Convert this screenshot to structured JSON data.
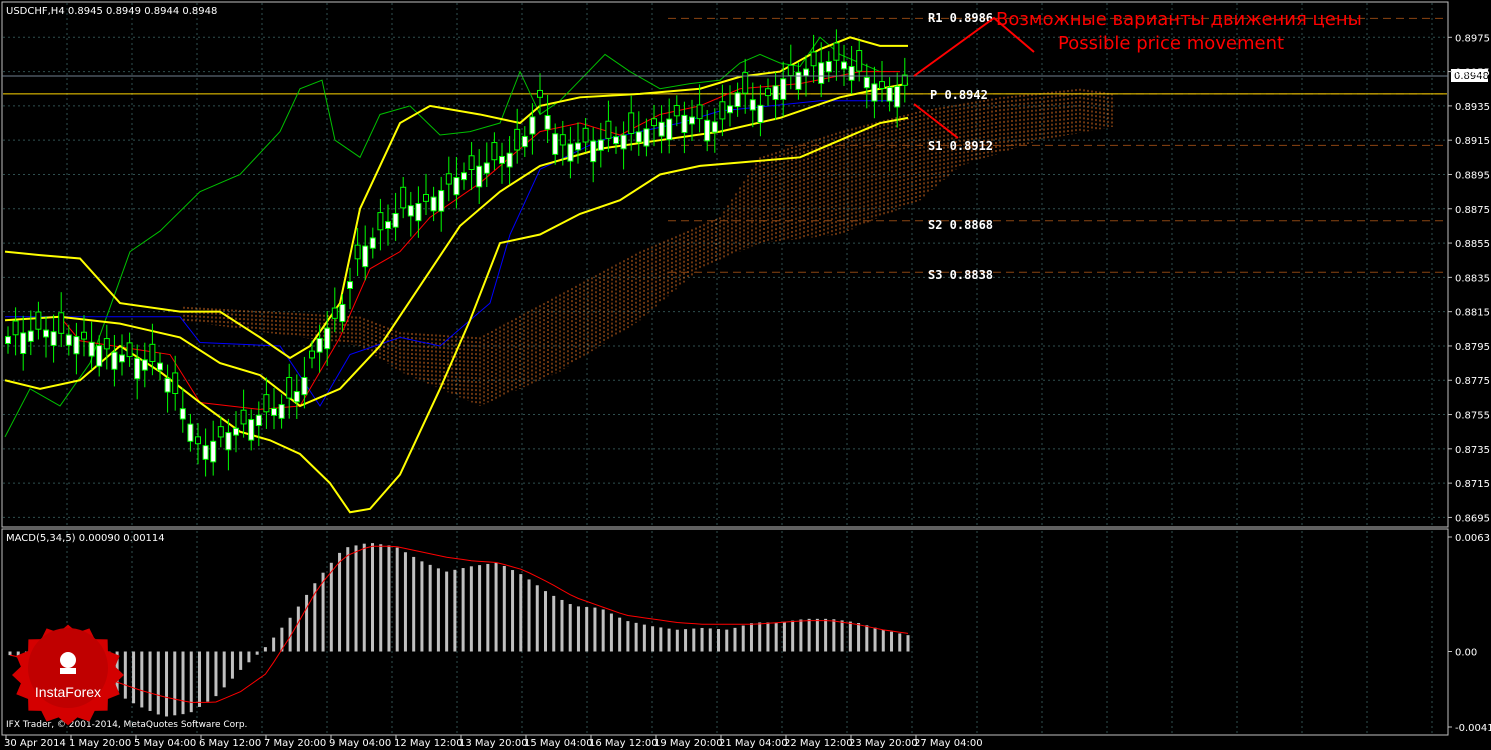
{
  "main_panel": {
    "title": "USDCHF,H4  0.8945 0.8949 0.8944 0.8948",
    "current_price_label": "0.8948",
    "price_ticks": [
      "0.8975",
      "0.8955",
      "0.8935",
      "0.8915",
      "0.8895",
      "0.8875",
      "0.8855",
      "0.8835",
      "0.8815",
      "0.8795",
      "0.8775",
      "0.8755",
      "0.8735",
      "0.8715",
      "0.8695"
    ]
  },
  "annotations": {
    "russian_text": "Возможные варианты движения цены",
    "english_text": "Possible price movement"
  },
  "pivot_levels": [
    {
      "name": "R1",
      "value": 0.8986,
      "label": "R1  0.8986"
    },
    {
      "name": "P",
      "value": 0.8942,
      "label": "P  0.8942"
    },
    {
      "name": "S1",
      "value": 0.8912,
      "label": "S1  0.8912"
    },
    {
      "name": "S2",
      "value": 0.8868,
      "label": "S2  0.8868"
    },
    {
      "name": "S3",
      "value": 0.8838,
      "label": "S3  0.8838"
    }
  ],
  "macd_panel": {
    "title": "MACD(5,34,5) 0.00090 0.00114",
    "ticks": [
      "0.00631",
      "0.00",
      "-0.00416"
    ]
  },
  "x_axis_labels": [
    "30 Apr 2014",
    "1 May 20:00",
    "5 May 04:00",
    "6 May 12:00",
    "7 May 20:00",
    "9 May 04:00",
    "12 May 12:00",
    "13 May 20:00",
    "15 May 04:00",
    "16 May 12:00",
    "19 May 20:00",
    "21 May 04:00",
    "22 May 12:00",
    "23 May 20:00",
    "27 May 04:00"
  ],
  "footer": {
    "copyright": "IFX Trader, © 2001-2014, MetaQuotes Software Corp.",
    "logo_text": "InstaForex"
  },
  "colors": {
    "background": "#000000",
    "grid": "#2f4f4f",
    "bollinger": "#ffff00",
    "tenkan": "#ff0000",
    "kijun": "#0000ff",
    "chikou": "#00c000",
    "kumo": "#d2691e",
    "pivot": "#8b4513",
    "macd_hist": "#c0c0c0",
    "macd_signal": "#ff0000",
    "annotation": "#ff0000",
    "bull_candle": "#ffffff",
    "bear_candle": "#000000"
  },
  "chart_data": {
    "type": "line",
    "symbol": "USDCHF",
    "timeframe": "H4",
    "x": [
      0,
      5,
      10,
      15,
      20,
      25,
      30,
      35,
      40,
      45,
      50,
      55,
      60,
      65,
      70,
      75,
      80,
      85,
      90,
      95,
      100,
      105,
      110,
      115,
      120,
      125,
      130,
      135,
      140
    ],
    "close": [
      0.8805,
      0.8795,
      0.8788,
      0.8801,
      0.8803,
      0.879,
      0.878,
      0.8779,
      0.8775,
      0.874,
      0.8742,
      0.8745,
      0.8755,
      0.876,
      0.8795,
      0.8835,
      0.887,
      0.888,
      0.8895,
      0.8905,
      0.89,
      0.8915,
      0.892,
      0.8925,
      0.8932,
      0.894,
      0.8955,
      0.8963,
      0.8948
    ],
    "bb_upper": [
      0.885,
      0.8845,
      0.882,
      0.8818,
      0.8805,
      0.88,
      0.879,
      0.878,
      0.877,
      0.879,
      0.8885,
      0.8925,
      0.8935,
      0.893,
      0.8935,
      0.8945,
      0.8945,
      0.8948,
      0.895,
      0.895,
      0.895,
      0.8955,
      0.896,
      0.8975,
      0.8978,
      0.8972
    ],
    "bb_lower": [
      0.8775,
      0.877,
      0.8772,
      0.8775,
      0.875,
      0.874,
      0.8735,
      0.872,
      0.87,
      0.87,
      0.874,
      0.88,
      0.884,
      0.886,
      0.887,
      0.8875,
      0.8885,
      0.8895,
      0.89,
      0.8902,
      0.8905,
      0.891,
      0.892,
      0.8925
    ],
    "ylim": [
      0.869,
      0.8995
    ],
    "grid": true,
    "macd": {
      "histogram": [
        -0.0002,
        -0.0006,
        -0.001,
        -0.0015,
        -0.0022,
        -0.003,
        -0.0036,
        -0.0034,
        -0.0025,
        -0.001,
        0.0003,
        0.002,
        0.004,
        0.0057,
        0.006,
        0.0058,
        0.005,
        0.0044,
        0.0047,
        0.0049,
        0.0042,
        0.0032,
        0.0025,
        0.0024,
        0.0017,
        0.0014,
        0.0012,
        0.0013,
        0.0012,
        0.0016,
        0.0016,
        0.0018,
        0.0018,
        0.0016,
        0.0012,
        0.0009
      ],
      "signal": [
        -0.0002,
        -0.0005,
        -0.0008,
        -0.0012,
        -0.0016,
        -0.0021,
        -0.0025,
        -0.0028,
        -0.0028,
        -0.0022,
        -0.0012,
        0.001,
        0.0035,
        0.0052,
        0.0058,
        0.0058,
        0.0055,
        0.0052,
        0.005,
        0.0049,
        0.0045,
        0.0038,
        0.003,
        0.0025,
        0.002,
        0.0018,
        0.0016,
        0.0015,
        0.0015,
        0.0015,
        0.0016,
        0.0017,
        0.0017,
        0.0015,
        0.0012,
        0.001
      ],
      "ylim": [
        -0.00416,
        0.00631
      ]
    }
  }
}
